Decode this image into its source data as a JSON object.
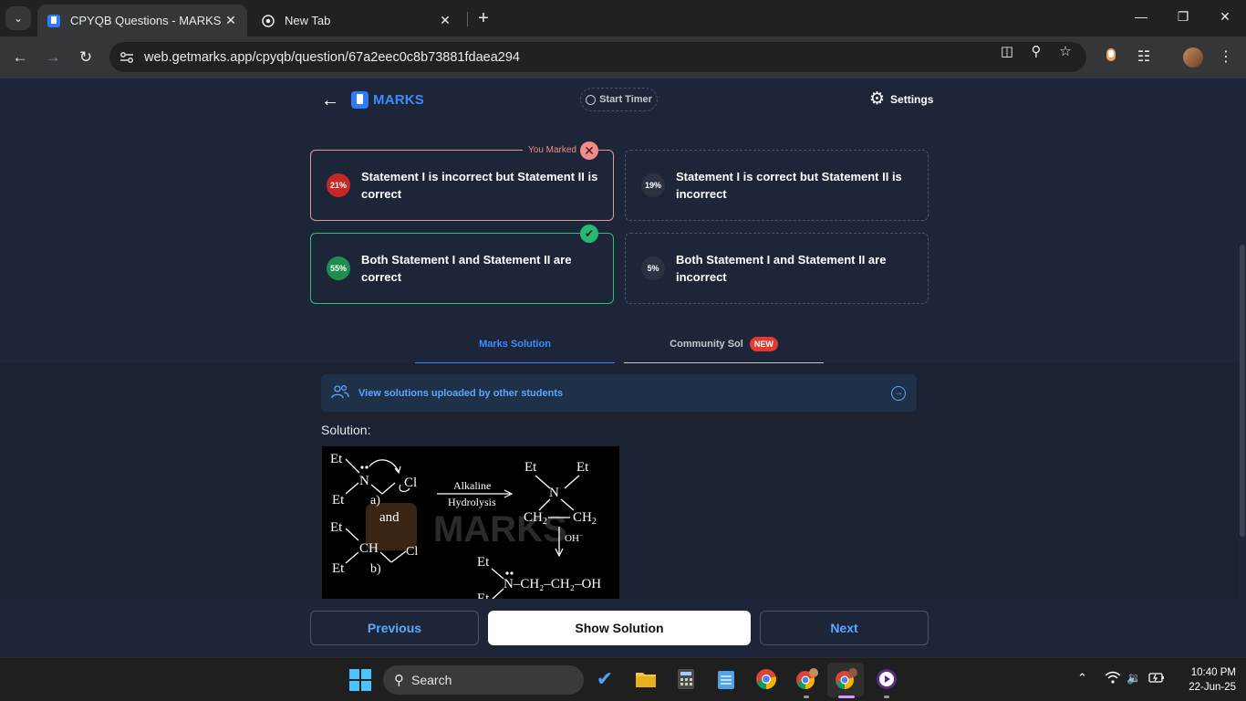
{
  "browser": {
    "tabs": [
      {
        "title": "CPYQB Questions - MARKS App",
        "active": true
      },
      {
        "title": "New Tab",
        "active": false
      }
    ],
    "url": "web.getmarks.app/cpyqb/question/67a2eec0c8b73881fdaea294"
  },
  "header": {
    "logo_text": "MARKS",
    "timer_label": "Start Timer",
    "settings_label": "Settings"
  },
  "options": [
    {
      "percent": "21%",
      "text": "Statement I is incorrect but Statement II is correct",
      "status": "marked-wrong"
    },
    {
      "percent": "19%",
      "text": "Statement I is correct but Statement II is incorrect",
      "status": "none"
    },
    {
      "percent": "55%",
      "text": "Both Statement I and Statement II are correct",
      "status": "correct"
    },
    {
      "percent": "5%",
      "text": "Both Statement I and Statement II are incorrect",
      "status": "none"
    }
  ],
  "marked_label": "You Marked",
  "solution_tabs": {
    "marks": "Marks Solution",
    "community": "Community Sol",
    "new_badge": "NEW"
  },
  "view_solutions": "View solutions uploaded by other students",
  "solution_label": "Solution:",
  "solution_image": {
    "et": "Et",
    "n": "N",
    "cl": "Cl",
    "alkaline": "Alkaline",
    "hydrolysis": "Hydrolysis",
    "a": "a)",
    "b": "b)",
    "and": "and",
    "ch": "CH",
    "ch2": "CH",
    "sub2": "2",
    "oh_minus": "OH",
    "minus": "−",
    "product_tail": "N–CH₂–CH₂–OH",
    "watermark": "MARKS"
  },
  "footer": {
    "previous": "Previous",
    "show_solution": "Show Solution",
    "next": "Next"
  },
  "taskbar": {
    "search_label": "Search",
    "time": "10:40 PM",
    "date": "22-Jun-25"
  },
  "colors": {
    "accent": "#3b8cff",
    "wrong": "#c62828",
    "correct": "#1e8e4e"
  }
}
